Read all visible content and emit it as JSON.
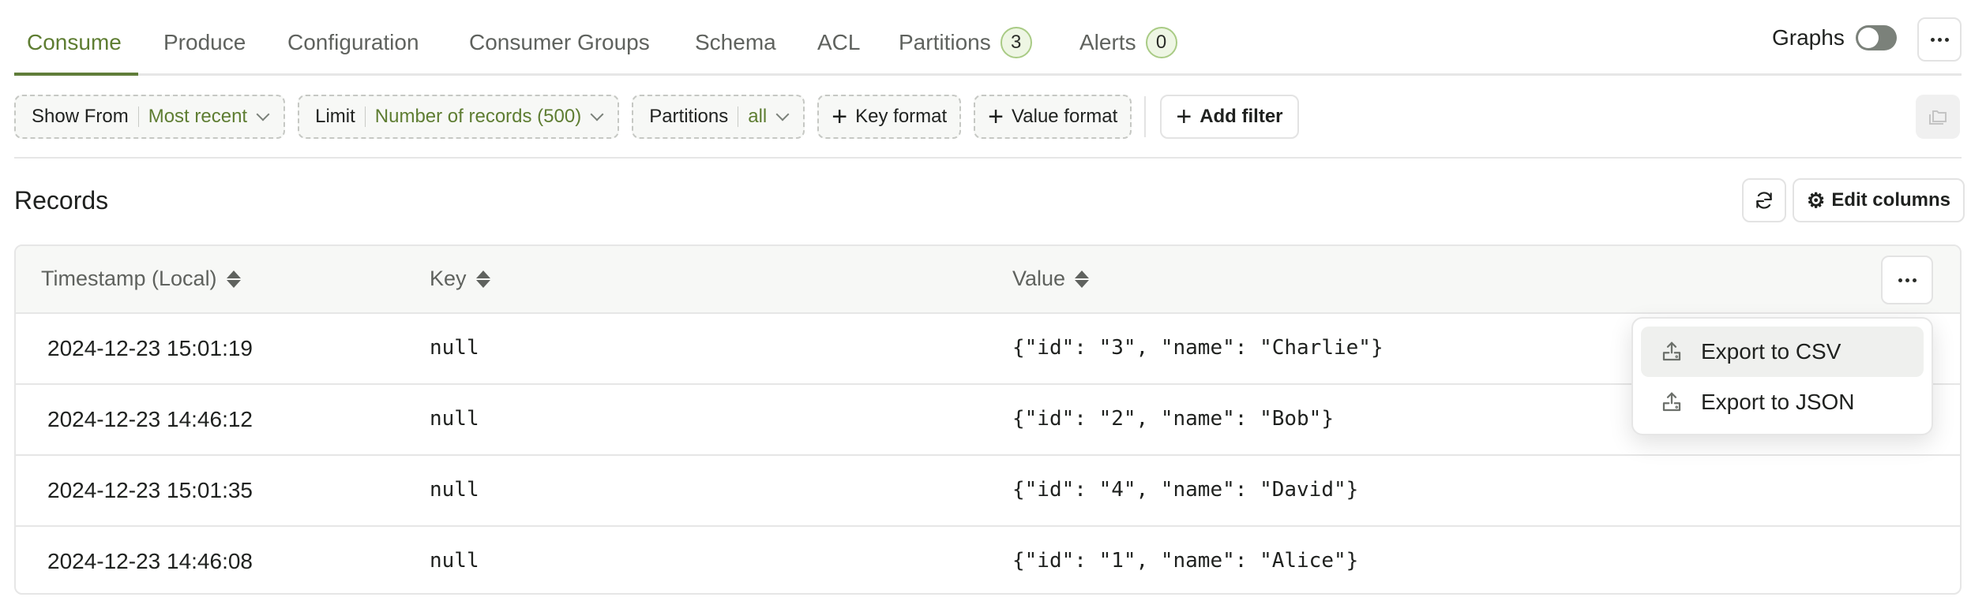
{
  "tabs": [
    {
      "label": "Consume",
      "active": true
    },
    {
      "label": "Produce"
    },
    {
      "label": "Configuration"
    },
    {
      "label": "Consumer Groups"
    },
    {
      "label": "Schema"
    },
    {
      "label": "ACL"
    },
    {
      "label": "Partitions",
      "badge": "3"
    },
    {
      "label": "Alerts",
      "badge": "0"
    }
  ],
  "header": {
    "graphs_label": "Graphs",
    "graphs_toggle_on": false
  },
  "filters": {
    "show_from": {
      "label": "Show From",
      "value": "Most recent"
    },
    "limit": {
      "label": "Limit",
      "value": "Number of records (500)"
    },
    "partitions": {
      "label": "Partitions",
      "value": "all"
    },
    "key_format": "Key format",
    "value_format": "Value format",
    "add_filter": "Add filter"
  },
  "records": {
    "title": "Records",
    "edit_columns_label": "Edit columns",
    "columns": [
      "Timestamp (Local)",
      "Key",
      "Value"
    ],
    "rows": [
      {
        "timestamp": "2024-12-23 15:01:19",
        "key": "null",
        "value": "{\"id\": \"3\", \"name\": \"Charlie\"}"
      },
      {
        "timestamp": "2024-12-23 14:46:12",
        "key": "null",
        "value": "{\"id\": \"2\", \"name\": \"Bob\"}"
      },
      {
        "timestamp": "2024-12-23 15:01:35",
        "key": "null",
        "value": "{\"id\": \"4\", \"name\": \"David\"}"
      },
      {
        "timestamp": "2024-12-23 14:46:08",
        "key": "null",
        "value": "{\"id\": \"1\", \"name\": \"Alice\"}"
      }
    ]
  },
  "export_menu": {
    "items": [
      {
        "label": "Export to CSV",
        "icon": "upload-icon",
        "highlighted": true
      },
      {
        "label": "Export to JSON",
        "icon": "upload-icon"
      }
    ]
  },
  "colors": {
    "accent": "#5e7d32",
    "badge_bg": "#eef6e4",
    "badge_border": "#a9cb85"
  }
}
